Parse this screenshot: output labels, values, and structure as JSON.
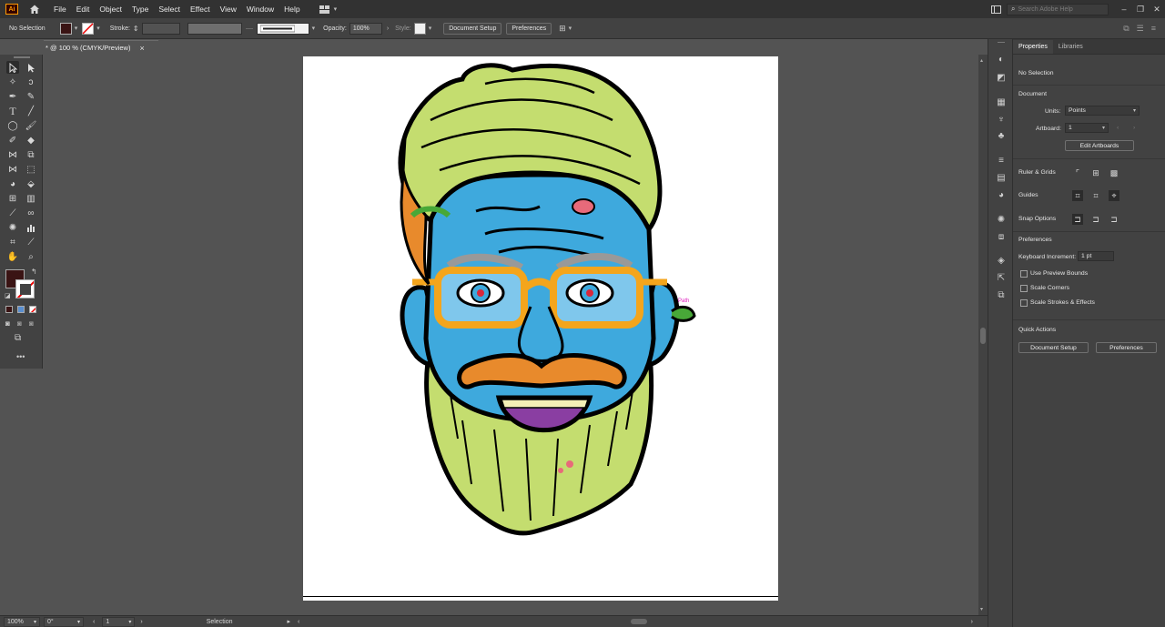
{
  "app": {
    "logo": "Ai",
    "menu": [
      "File",
      "Edit",
      "Object",
      "Type",
      "Select",
      "Effect",
      "View",
      "Window",
      "Help"
    ],
    "search_placeholder": "Search Adobe Help"
  },
  "control_bar": {
    "selection_state": "No Selection",
    "fill_color": "#3a1414",
    "stroke_label": "Stroke:",
    "opacity_label": "Opacity:",
    "opacity_value": "100%",
    "style_label": "Style:",
    "document_setup": "Document Setup",
    "preferences": "Preferences"
  },
  "document_tab": {
    "title": "* @ 100 % (CMYK/Preview)"
  },
  "artwork": {
    "annotation": "Path"
  },
  "status_bar": {
    "zoom": "100%",
    "rotation": "0°",
    "artboard": "1",
    "tool": "Selection"
  },
  "properties_panel": {
    "tabs": [
      "Properties",
      "Libraries"
    ],
    "selection": "No Selection",
    "document_heading": "Document",
    "units_label": "Units:",
    "units_value": "Points",
    "artboard_label": "Artboard:",
    "artboard_value": "1",
    "edit_artboards": "Edit Artboards",
    "rulers_grids": "Ruler & Grids",
    "guides": "Guides",
    "snap_options": "Snap Options",
    "preferences_heading": "Preferences",
    "keyboard_increment_label": "Keyboard Increment:",
    "keyboard_increment_value": "1 pt",
    "use_preview_bounds": "Use Preview Bounds",
    "scale_corners": "Scale Corners",
    "scale_strokes": "Scale Strokes & Effects",
    "quick_actions": "Quick Actions",
    "document_setup": "Document Setup",
    "preferences_button": "Preferences"
  }
}
